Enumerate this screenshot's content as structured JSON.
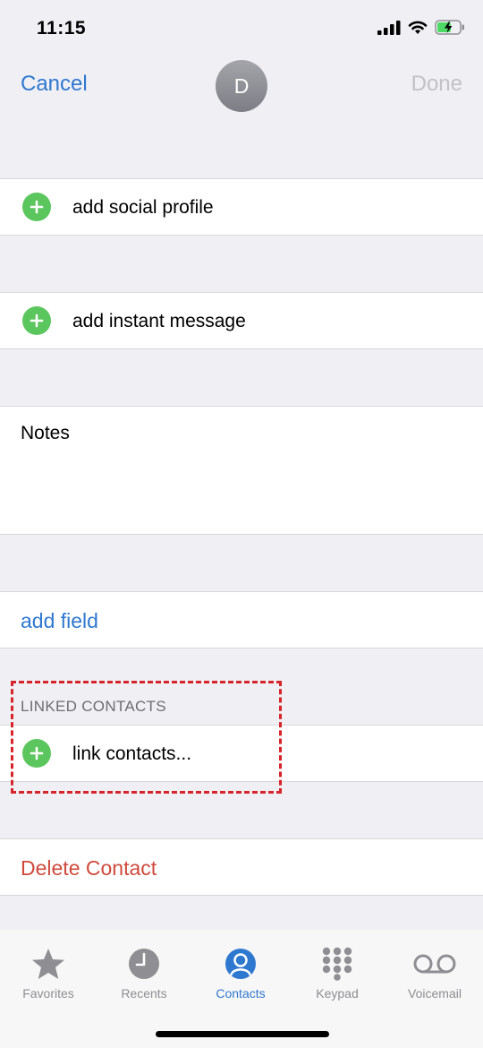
{
  "status_bar": {
    "time": "11:15"
  },
  "nav": {
    "cancel": "Cancel",
    "avatar_initial": "D",
    "done": "Done"
  },
  "rows": {
    "social_profile": "add social profile",
    "instant_message": "add instant message",
    "notes": "Notes",
    "add_field": "add field",
    "linked_header": "LINKED CONTACTS",
    "link_contacts": "link contacts...",
    "delete_contact": "Delete Contact"
  },
  "tabs": [
    {
      "label": "Favorites",
      "icon": "star-icon",
      "active": false
    },
    {
      "label": "Recents",
      "icon": "clock-icon",
      "active": false
    },
    {
      "label": "Contacts",
      "icon": "person-circle-icon",
      "active": true
    },
    {
      "label": "Keypad",
      "icon": "keypad-icon",
      "active": false
    },
    {
      "label": "Voicemail",
      "icon": "voicemail-icon",
      "active": false
    }
  ],
  "colors": {
    "accent": "#2f78d0",
    "add_green": "#5cc65e",
    "destructive": "#cf4a3c",
    "highlight": "#d6242a"
  }
}
